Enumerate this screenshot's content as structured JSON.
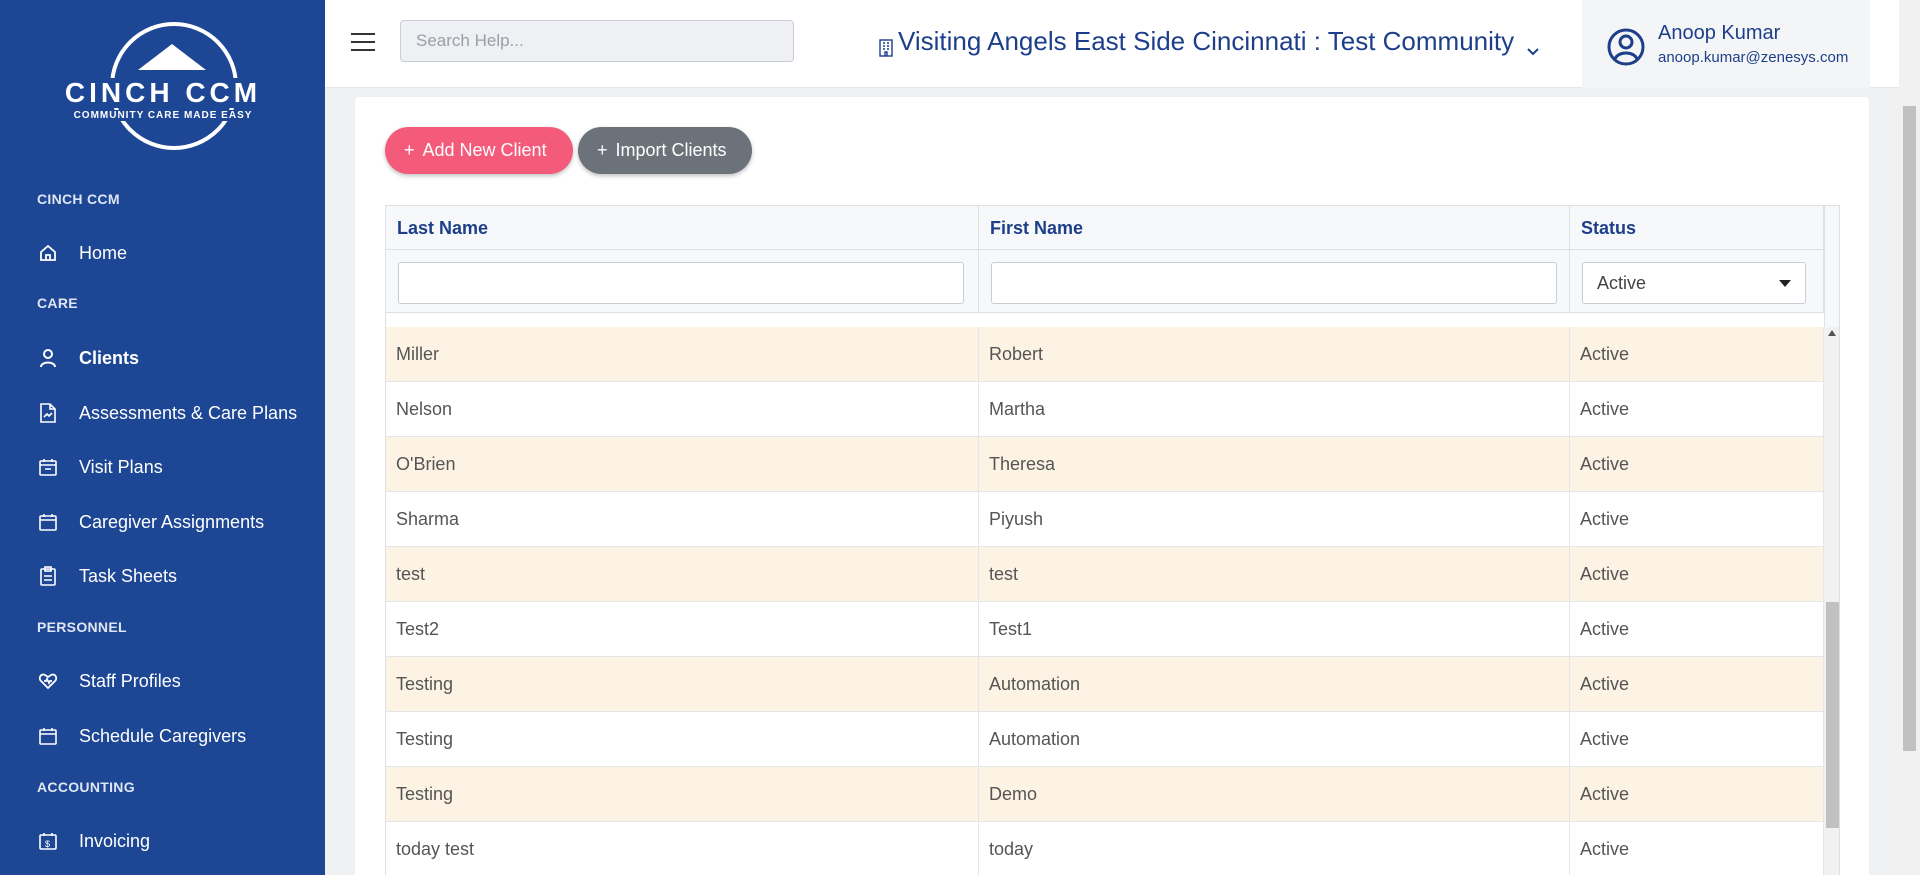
{
  "sidebar": {
    "logo": {
      "title": "CINCH CCM",
      "subtitle": "COMMUNITY CARE MADE EASY"
    },
    "sections": [
      {
        "label": "CINCH CCM"
      },
      {
        "label": "CARE"
      },
      {
        "label": "PERSONNEL"
      },
      {
        "label": "ACCOUNTING"
      }
    ],
    "items": [
      {
        "label": "Home",
        "icon": "home-icon"
      },
      {
        "label": "Clients",
        "icon": "user-icon"
      },
      {
        "label": "Assessments & Care Plans",
        "icon": "document-icon"
      },
      {
        "label": "Visit Plans",
        "icon": "calendar-icon"
      },
      {
        "label": "Caregiver Assignments",
        "icon": "calendar-icon"
      },
      {
        "label": "Task Sheets",
        "icon": "clipboard-icon"
      },
      {
        "label": "Staff Profiles",
        "icon": "heart-icon"
      },
      {
        "label": "Schedule Caregivers",
        "icon": "calendar-icon"
      },
      {
        "label": "Invoicing",
        "icon": "invoice-icon"
      }
    ],
    "active_item": "Clients",
    "colors": {
      "background": "#1d4694",
      "text": "#ffffff"
    }
  },
  "header": {
    "search": {
      "placeholder": "Search Help...",
      "value": ""
    },
    "community": "Visiting Angels East Side Cincinnati : Test Community",
    "user": {
      "name": "Anoop Kumar",
      "email": "anoop.kumar@zenesys.com"
    }
  },
  "toolbar": {
    "add_label": "Add New Client",
    "import_label": "Import Clients",
    "plus_glyph": "+",
    "colors": {
      "add": "#f45b7a",
      "import": "#6b7279"
    }
  },
  "table": {
    "columns": [
      "Last Name",
      "First Name",
      "Status"
    ],
    "filters": {
      "last_name": "",
      "first_name": "",
      "status": "Active"
    },
    "rows": [
      {
        "last": "Miller",
        "first": "Robert",
        "status": "Active"
      },
      {
        "last": "Nelson",
        "first": "Martha",
        "status": "Active"
      },
      {
        "last": "O'Brien",
        "first": "Theresa",
        "status": "Active"
      },
      {
        "last": "Sharma",
        "first": "Piyush",
        "status": "Active"
      },
      {
        "last": "test",
        "first": "test",
        "status": "Active"
      },
      {
        "last": "Test2",
        "first": "Test1",
        "status": "Active"
      },
      {
        "last": "Testing",
        "first": "Automation",
        "status": "Active"
      },
      {
        "last": "Testing",
        "first": "Automation",
        "status": "Active"
      },
      {
        "last": "Testing",
        "first": "Demo",
        "status": "Active"
      },
      {
        "last": "today test",
        "first": "today",
        "status": "Active"
      }
    ],
    "colors": {
      "alt_row": "#fdf3e4",
      "header_text": "#1d3f8a"
    }
  }
}
